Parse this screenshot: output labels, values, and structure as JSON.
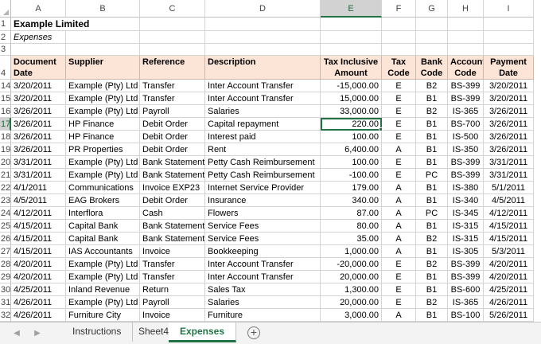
{
  "columns": [
    "A",
    "B",
    "C",
    "D",
    "E",
    "F",
    "G",
    "H",
    "I"
  ],
  "selected_column": "E",
  "row1": {
    "num": "1",
    "company": "Example Limited"
  },
  "row2": {
    "num": "2",
    "subtitle": "Expenses"
  },
  "row3": {
    "num": "3"
  },
  "header_row": {
    "num": "4",
    "labels": [
      "Document Date",
      "Supplier",
      "Reference",
      "Description",
      "Tax Inclusive Amount",
      "Tax Code",
      "Bank Code",
      "Account Code",
      "Payment Date"
    ]
  },
  "rows": [
    {
      "num": "14",
      "cells": [
        "3/20/2011",
        "Example (Pty) Ltd",
        "Transfer",
        "Inter Account Transfer",
        "-15,000.00",
        "E",
        "B2",
        "BS-399",
        "3/20/2011"
      ]
    },
    {
      "num": "15",
      "cells": [
        "3/20/2011",
        "Example (Pty) Ltd",
        "Transfer",
        "Inter Account Transfer",
        "15,000.00",
        "E",
        "B1",
        "BS-399",
        "3/20/2011"
      ]
    },
    {
      "num": "16",
      "cells": [
        "3/26/2011",
        "Example (Pty) Ltd",
        "Payroll",
        "Salaries",
        "33,000.00",
        "E",
        "B2",
        "IS-365",
        "3/26/2011"
      ]
    },
    {
      "num": "17",
      "cells": [
        "3/26/2011",
        "HP Finance",
        "Debit Order",
        "Capital repayment",
        "220.00",
        "E",
        "B1",
        "BS-700",
        "3/26/2011"
      ]
    },
    {
      "num": "18",
      "cells": [
        "3/26/2011",
        "HP Finance",
        "Debit Order",
        "Interest paid",
        "100.00",
        "E",
        "B1",
        "IS-500",
        "3/26/2011"
      ]
    },
    {
      "num": "19",
      "cells": [
        "3/26/2011",
        "PR Properties",
        "Debit Order",
        "Rent",
        "6,400.00",
        "A",
        "B1",
        "IS-350",
        "3/26/2011"
      ]
    },
    {
      "num": "20",
      "cells": [
        "3/31/2011",
        "Example (Pty) Ltd",
        "Bank Statement",
        "Petty Cash Reimbursement",
        "100.00",
        "E",
        "B1",
        "BS-399",
        "3/31/2011"
      ]
    },
    {
      "num": "21",
      "cells": [
        "3/31/2011",
        "Example (Pty) Ltd",
        "Bank Statement",
        "Petty Cash Reimbursement",
        "-100.00",
        "E",
        "PC",
        "BS-399",
        "3/31/2011"
      ]
    },
    {
      "num": "22",
      "cells": [
        "4/1/2011",
        "Communications",
        "Invoice EXP23",
        "Internet Service Provider",
        "179.00",
        "A",
        "B1",
        "IS-380",
        "5/1/2011"
      ]
    },
    {
      "num": "23",
      "cells": [
        "4/5/2011",
        "EAG Brokers",
        "Debit Order",
        "Insurance",
        "340.00",
        "A",
        "B1",
        "IS-340",
        "4/5/2011"
      ]
    },
    {
      "num": "24",
      "cells": [
        "4/12/2011",
        "Interflora",
        "Cash",
        "Flowers",
        "87.00",
        "A",
        "PC",
        "IS-345",
        "4/12/2011"
      ]
    },
    {
      "num": "25",
      "cells": [
        "4/15/2011",
        "Capital Bank",
        "Bank Statement",
        "Service Fees",
        "80.00",
        "A",
        "B1",
        "IS-315",
        "4/15/2011"
      ]
    },
    {
      "num": "26",
      "cells": [
        "4/15/2011",
        "Capital Bank",
        "Bank Statement",
        "Service Fees",
        "35.00",
        "A",
        "B2",
        "IS-315",
        "4/15/2011"
      ]
    },
    {
      "num": "27",
      "cells": [
        "4/15/2011",
        "IAS Accountants",
        "Invoice",
        "Bookkeeping",
        "1,000.00",
        "A",
        "B1",
        "IS-305",
        "5/3/2011"
      ]
    },
    {
      "num": "28",
      "cells": [
        "4/20/2011",
        "Example (Pty) Ltd",
        "Transfer",
        "Inter Account Transfer",
        "-20,000.00",
        "E",
        "B2",
        "BS-399",
        "4/20/2011"
      ]
    },
    {
      "num": "29",
      "cells": [
        "4/20/2011",
        "Example (Pty) Ltd",
        "Transfer",
        "Inter Account Transfer",
        "20,000.00",
        "E",
        "B1",
        "BS-399",
        "4/20/2011"
      ]
    },
    {
      "num": "30",
      "cells": [
        "4/25/2011",
        "Inland Revenue",
        "Return",
        "Sales Tax",
        "1,300.00",
        "E",
        "B1",
        "BS-600",
        "4/25/2011"
      ]
    },
    {
      "num": "31",
      "cells": [
        "4/26/2011",
        "Example (Pty) Ltd",
        "Payroll",
        "Salaries",
        "20,000.00",
        "E",
        "B2",
        "IS-365",
        "4/26/2011"
      ]
    },
    {
      "num": "32",
      "cells": [
        "4/26/2011",
        "Furniture City",
        "Invoice",
        "Furniture",
        "3,000.00",
        "A",
        "B1",
        "BS-100",
        "5/26/2011"
      ]
    }
  ],
  "active_row": "17",
  "tabs": [
    {
      "label": "Instructions",
      "active": false
    },
    {
      "label": "Sheet4",
      "active": false
    },
    {
      "label": "Expenses",
      "active": true
    }
  ],
  "nav": {
    "prev_icon": "chevron-left-icon",
    "next_icon": "chevron-right-icon",
    "add_icon": "plus-circle-icon",
    "prev_glyph": "◀",
    "next_glyph": "▶",
    "add_glyph": "+"
  },
  "colors": {
    "header_fill": "#fce4d6",
    "accent": "#217346",
    "selection": "#d2d2d2"
  }
}
